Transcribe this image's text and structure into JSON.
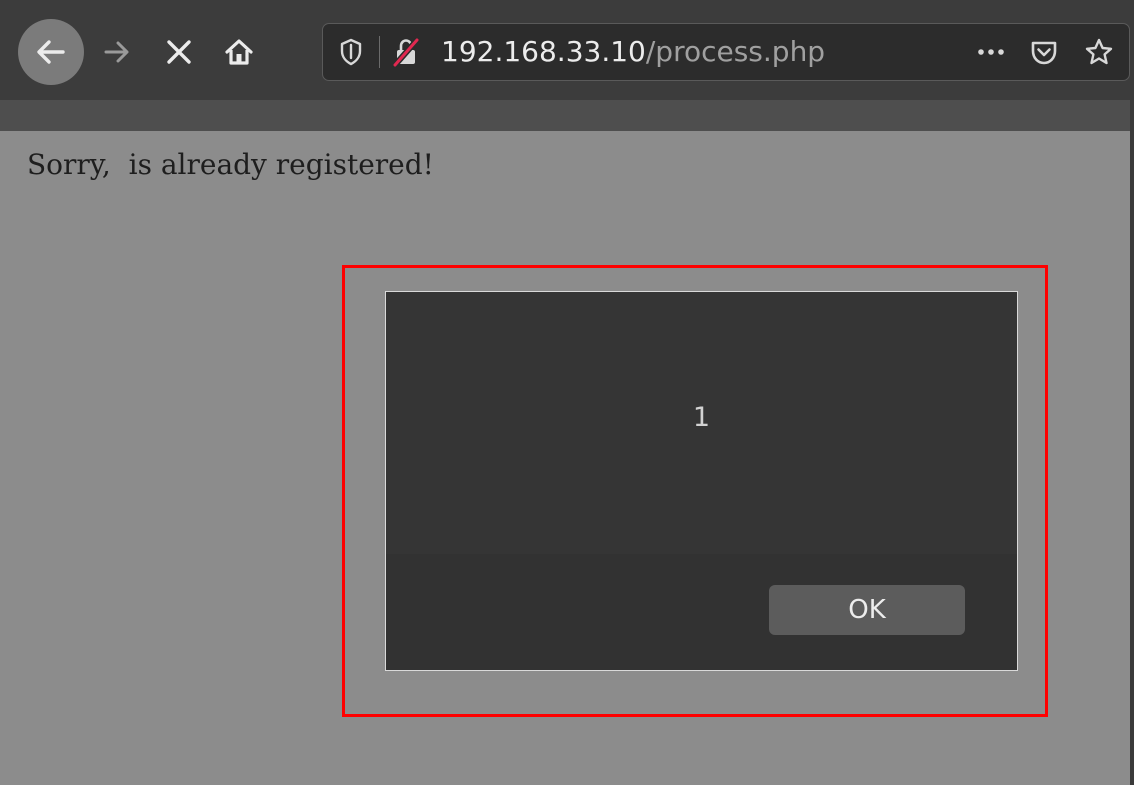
{
  "browser": {
    "nav": {
      "back_icon": "arrow-left-icon",
      "forward_icon": "arrow-right-icon",
      "stop_icon": "close-icon",
      "home_icon": "home-icon"
    },
    "urlbar": {
      "host": "192.168.33.10",
      "path": "/process.php",
      "icons": [
        "shield-icon",
        "insecure-lock-icon",
        "more-icon",
        "pocket-icon",
        "star-icon"
      ]
    }
  },
  "page": {
    "message": "Sorry,  is already registered!"
  },
  "alert": {
    "message": "1",
    "ok_label": "OK"
  },
  "colors": {
    "highlight": "#ff0000",
    "insecure_slash": "#e22850",
    "page_background": "#8c8c8c",
    "dialog_background": "#333333"
  }
}
